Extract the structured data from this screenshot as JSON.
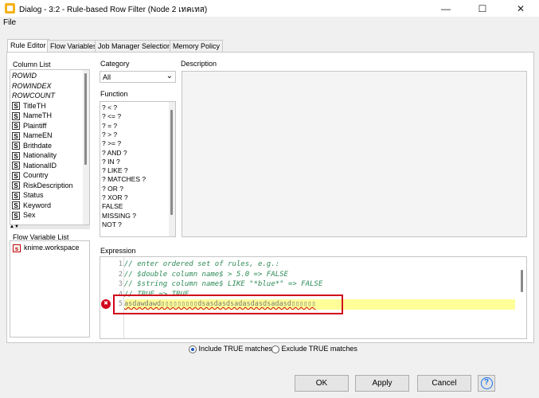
{
  "window": {
    "title": "Dialog - 3:2 - Rule-based Row Filter (Node 2 เทคเทส)",
    "minimize": "—",
    "maximize": "☐",
    "close": "✕"
  },
  "menu": {
    "file": "File"
  },
  "tabs": [
    {
      "label": "Rule Editor"
    },
    {
      "label": "Flow Variables"
    },
    {
      "label": "Job Manager Selection"
    },
    {
      "label": "Memory Policy"
    }
  ],
  "column_list": {
    "header": "Column List",
    "special": [
      "ROWID",
      "ROWINDEX",
      "ROWCOUNT"
    ],
    "type_badge": "S",
    "columns": [
      "TitleTH",
      "NameTH",
      "Plaintiff",
      "NameEN",
      "Brithdate",
      "Nationality",
      "NationalID",
      "Country",
      "RiskDescription",
      "Status",
      "Keyword",
      "Sex"
    ]
  },
  "flow_variables": {
    "header": "Flow Variable List",
    "badge": "s",
    "items": [
      "knime.workspace"
    ]
  },
  "category": {
    "label": "Category",
    "value": "All"
  },
  "function": {
    "label": "Function",
    "items": [
      "? < ?",
      "? <= ?",
      "? = ?",
      "? > ?",
      "? >= ?",
      "? AND ?",
      "? IN ?",
      "? LIKE ?",
      "? MATCHES ?",
      "? OR ?",
      "? XOR ?",
      "FALSE",
      "MISSING ?",
      "NOT ?"
    ]
  },
  "description": {
    "label": "Description"
  },
  "expression": {
    "label": "Expression",
    "lines": [
      "// enter ordered set of rules, e.g.:",
      "// $double column name$ > 5.0 => FALSE",
      "// $string column name$ LIKE \"*blue*\" => FALSE",
      "// TRUE => TRUE",
      "asdawdawd▯▯▯▯▯▯▯▯▯dsasdasdsadasdasdsadasd▯▯▯▯▯▯"
    ],
    "line_numbers": [
      "1",
      "2",
      "3",
      "4",
      "5"
    ],
    "error_marker": "✖"
  },
  "radios": {
    "include": "Include TRUE matches",
    "exclude": "Exclude TRUE matches",
    "selected": "include"
  },
  "buttons": {
    "ok": "OK",
    "apply": "Apply",
    "cancel": "Cancel",
    "help": "?"
  },
  "colors": {
    "error": "#d0021b",
    "highlight": "#ffff99",
    "comment": "#2e8b57",
    "help": "#1a73e8"
  }
}
